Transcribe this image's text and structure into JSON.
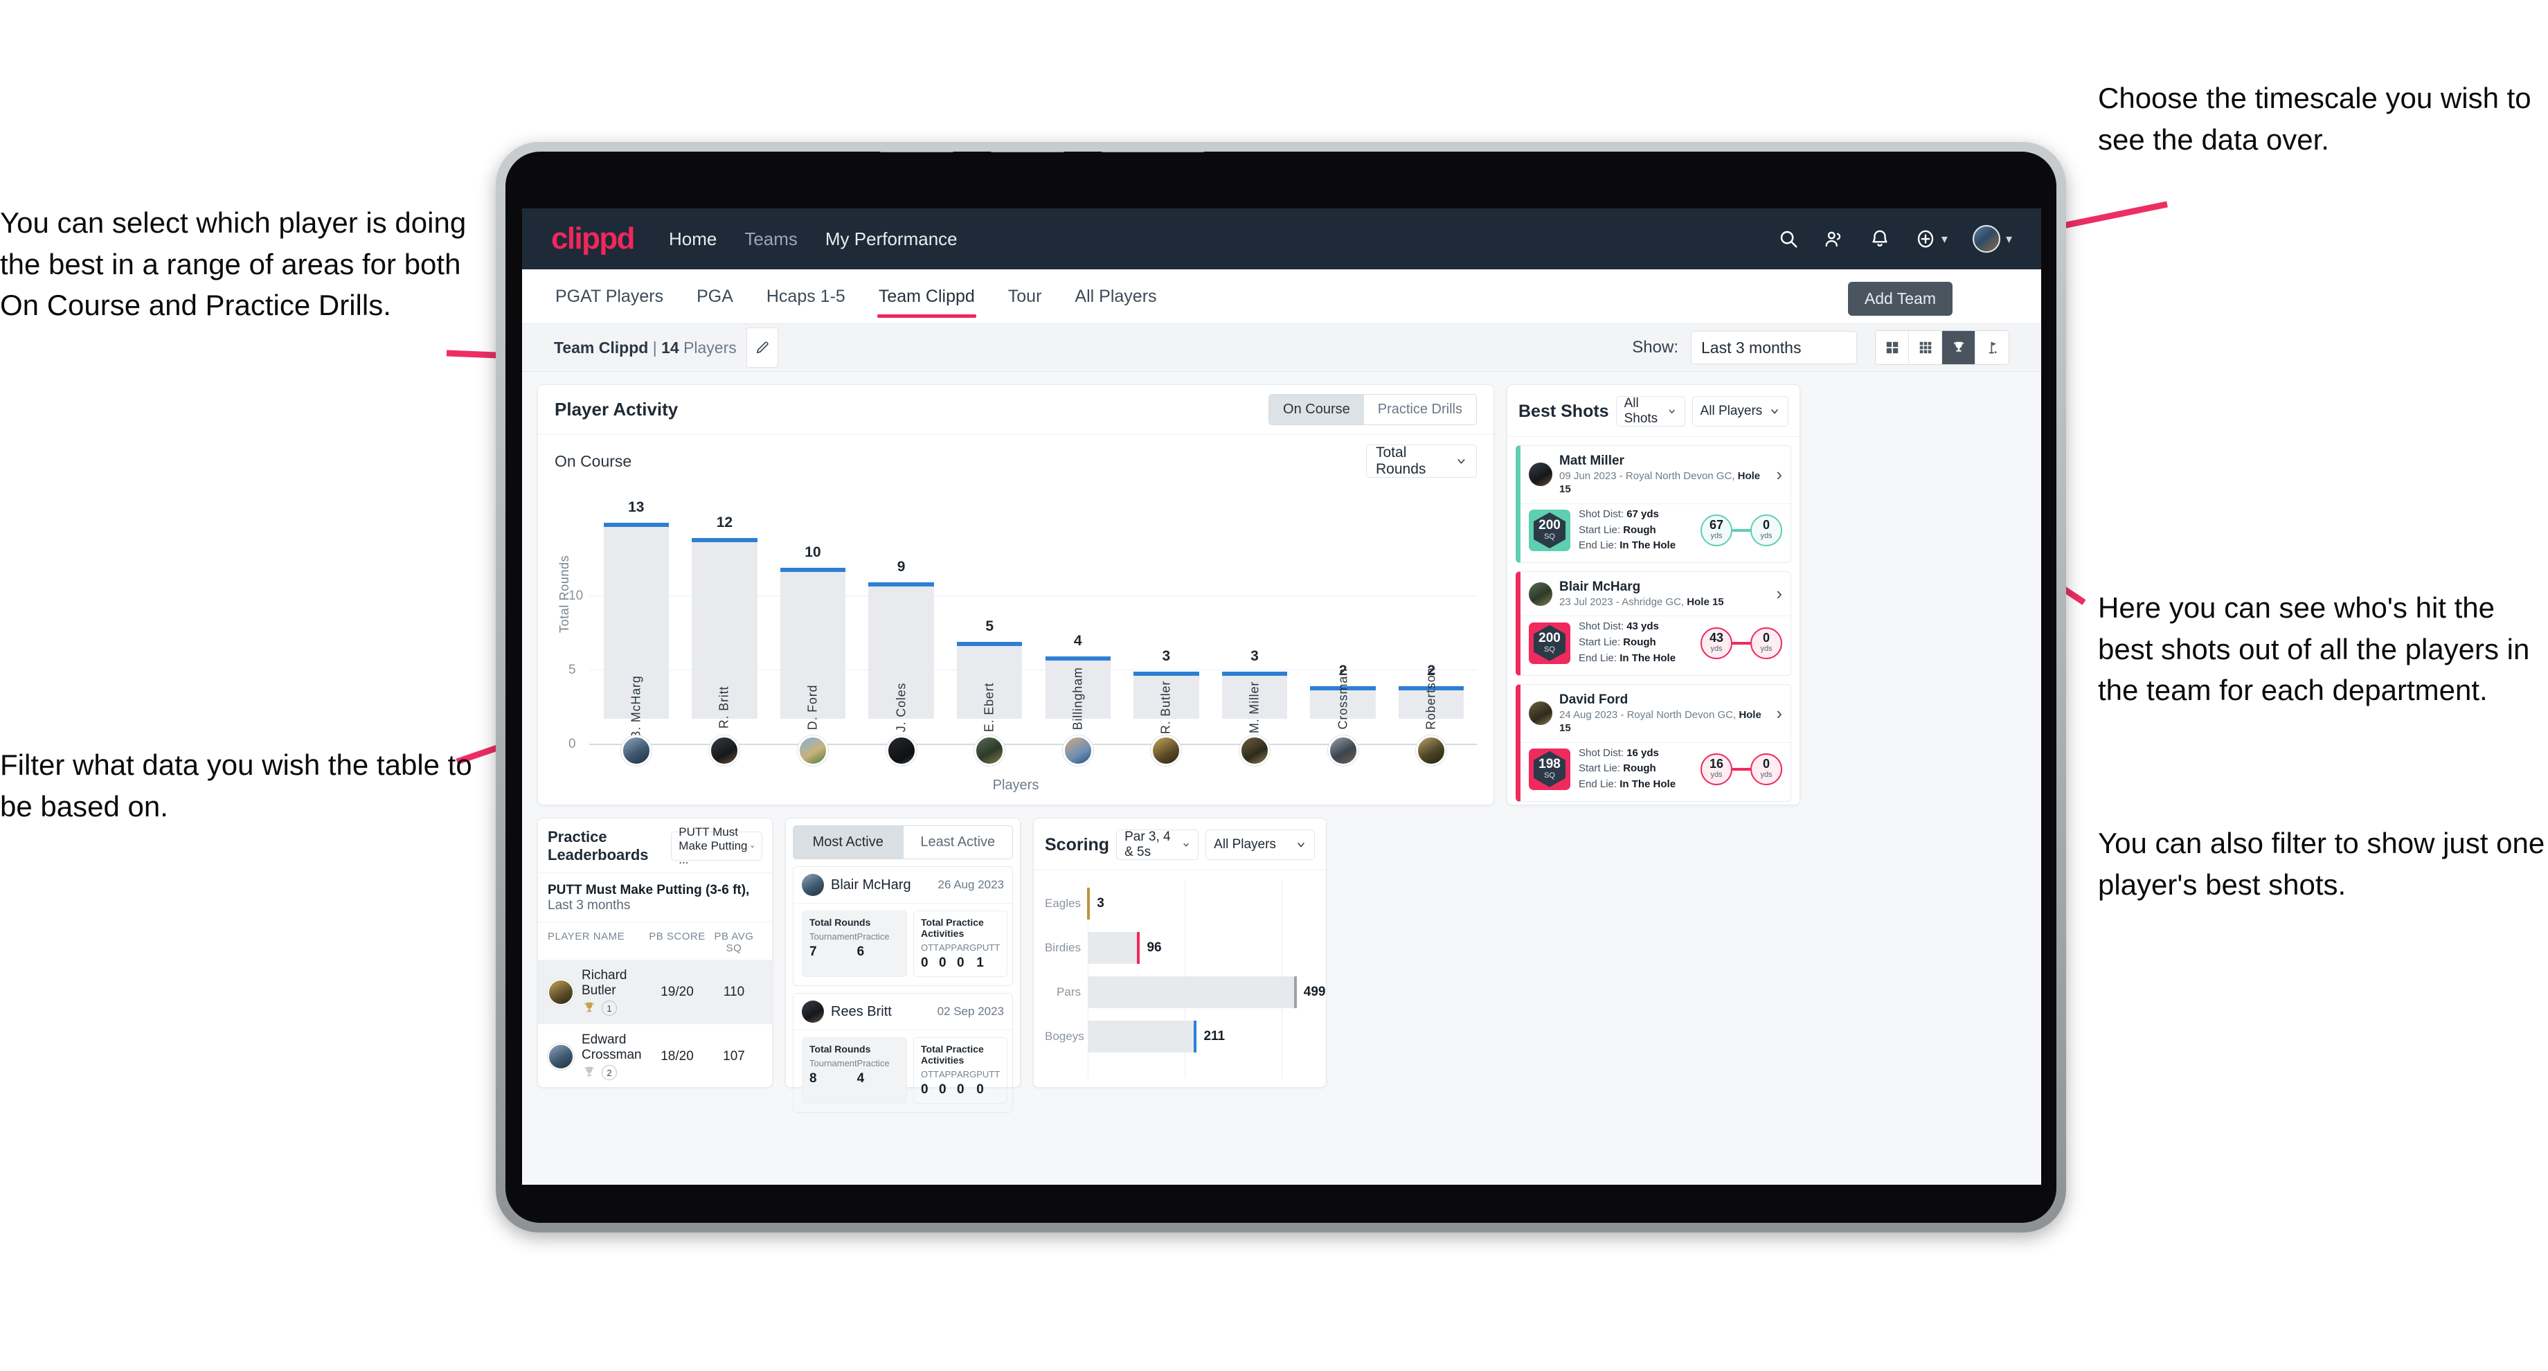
{
  "annotations": {
    "left_top": "You can select which player is doing the best in a range of areas for both On Course and Practice Drills.",
    "left_bottom": "Filter what data you wish the table to be based on.",
    "right_top": "Choose the timescale you wish to see the data over.",
    "right_mid": "Here you can see who's hit the best shots out of all the players in the team for each department.",
    "right_bottom": "You can also filter to show just one player's best shots."
  },
  "colors": {
    "brand_pink": "#f0275b",
    "nav_dark": "#1e2a38",
    "bar_blue": "#2e7fd4",
    "teal": "#5ecfb1",
    "gold": "#bd9340",
    "annotation_arrow": "#ed2e63"
  },
  "topnav": {
    "logo": "clippd",
    "links": [
      {
        "label": "Home",
        "active": true
      },
      {
        "label": "Teams",
        "active": false
      },
      {
        "label": "My Performance",
        "active": true
      }
    ],
    "icons": [
      "search-icon",
      "people-icon",
      "bell-icon",
      "plus-circle-icon",
      "avatar"
    ]
  },
  "tabs": [
    {
      "label": "PGAT Players",
      "active": false
    },
    {
      "label": "PGA",
      "active": false
    },
    {
      "label": "Hcaps 1-5",
      "active": false
    },
    {
      "label": "Team Clippd",
      "active": true
    },
    {
      "label": "Tour",
      "active": false
    },
    {
      "label": "All Players",
      "active": false
    }
  ],
  "tooltip": {
    "add_team": "Add Team"
  },
  "subbar": {
    "team_name": "Team Clippd",
    "separator": "|",
    "player_count": "14",
    "players_word": "Players",
    "edit_icon": "pencil-icon",
    "show_label": "Show:",
    "timescale_value": "Last 3 months",
    "view_toggles": [
      {
        "icon": "grid-4-icon",
        "active": false
      },
      {
        "icon": "grid-9-icon",
        "active": false
      },
      {
        "icon": "trophy-icon",
        "active": true
      },
      {
        "icon": "golf-flag-icon",
        "active": false
      }
    ]
  },
  "player_activity": {
    "title": "Player Activity",
    "segments": [
      {
        "label": "On Course",
        "active": true
      },
      {
        "label": "Practice Drills",
        "active": false
      }
    ],
    "sub_label": "On Course",
    "metric_select": "Total Rounds"
  },
  "chart_data": [
    {
      "type": "bar",
      "title": "Player Activity",
      "xlabel": "Players",
      "ylabel": "Total Rounds",
      "ylim": [
        0,
        14
      ],
      "yticks": [
        0,
        5,
        10
      ],
      "grid": true,
      "categories": [
        "B. McHarg",
        "R. Britt",
        "D. Ford",
        "J. Coles",
        "E. Ebert",
        "D. Billingham",
        "R. Butler",
        "M. Miller",
        "E. Crossman",
        "C. Robertson"
      ],
      "values": [
        13,
        12,
        10,
        9,
        5,
        4,
        3,
        3,
        2,
        2
      ]
    },
    {
      "type": "bar",
      "orientation": "horizontal",
      "title": "Scoring",
      "categories": [
        "Eagles",
        "Birdies",
        "Pars",
        "Bogeys"
      ],
      "values": [
        3,
        96,
        499,
        211
      ],
      "colors": [
        "#bd9340",
        "#f0275b",
        "#9aa3ab",
        "#2e7fd4"
      ],
      "xlim": [
        0,
        560
      ],
      "grid": true
    }
  ],
  "best_shots": {
    "title": "Best Shots",
    "shot_filter": "All Shots",
    "player_filter": "All Players",
    "cards": [
      {
        "name": "Matt Miller",
        "meta_prefix": "09 Jun 2023 - Royal North Devon GC,",
        "hole": "Hole 15",
        "sq": "200",
        "sq_unit": "SQ",
        "accent": "#5ecfb1",
        "shot_dist_label": "Shot Dist:",
        "shot_dist": "67 yds",
        "start_lie_label": "Start Lie:",
        "start_lie": "Rough",
        "end_lie_label": "End Lie:",
        "end_lie": "In The Hole",
        "from_value": "67",
        "from_unit": "yds",
        "to_value": "0",
        "to_unit": "yds"
      },
      {
        "name": "Blair McHarg",
        "meta_prefix": "23 Jul 2023 - Ashridge GC,",
        "hole": "Hole 15",
        "sq": "200",
        "sq_unit": "SQ",
        "accent": "#ef2a5e",
        "shot_dist_label": "Shot Dist:",
        "shot_dist": "43 yds",
        "start_lie_label": "Start Lie:",
        "start_lie": "Rough",
        "end_lie_label": "End Lie:",
        "end_lie": "In The Hole",
        "from_value": "43",
        "from_unit": "yds",
        "to_value": "0",
        "to_unit": "yds"
      },
      {
        "name": "David Ford",
        "meta_prefix": "24 Aug 2023 - Royal North Devon GC,",
        "hole": "Hole 15",
        "sq": "198",
        "sq_unit": "SQ",
        "accent": "#ef2a5e",
        "shot_dist_label": "Shot Dist:",
        "shot_dist": "16 yds",
        "start_lie_label": "Start Lie:",
        "start_lie": "Rough",
        "end_lie_label": "End Lie:",
        "end_lie": "In The Hole",
        "from_value": "16",
        "from_unit": "yds",
        "to_value": "0",
        "to_unit": "yds"
      }
    ]
  },
  "practice_leaderboards": {
    "title": "Practice Leaderboards",
    "drill_select": "PUTT Must Make Putting ...",
    "subtitle_bold": "PUTT Must Make Putting (3-6 ft),",
    "subtitle_rest": "Last 3 months",
    "columns": [
      "PLAYER NAME",
      "PB SCORE",
      "PB AVG SQ"
    ],
    "rows": [
      {
        "name": "Richard Butler",
        "rank": "1",
        "trophy": "gold",
        "pb_score": "19/20",
        "pb_avg_sq": "110",
        "highlight": true
      },
      {
        "name": "Edward Crossman",
        "rank": "2",
        "trophy": "silver",
        "pb_score": "18/20",
        "pb_avg_sq": "107",
        "highlight": false
      }
    ]
  },
  "activity_panel": {
    "tabs": [
      {
        "label": "Most Active",
        "active": true
      },
      {
        "label": "Least Active",
        "active": false
      }
    ],
    "rounds_title": "Total Rounds",
    "practice_title": "Total Practice Activities",
    "rounds_cols": [
      "Tournament",
      "Practice"
    ],
    "practice_cols": [
      "OTT",
      "APP",
      "ARG",
      "PUTT"
    ],
    "cards": [
      {
        "name": "Blair McHarg",
        "date": "26 Aug 2023",
        "tournament": "7",
        "practice": "6",
        "ott": "0",
        "app": "0",
        "arg": "0",
        "putt": "1"
      },
      {
        "name": "Rees Britt",
        "date": "02 Sep 2023",
        "tournament": "8",
        "practice": "4",
        "ott": "0",
        "app": "0",
        "arg": "0",
        "putt": "0"
      }
    ]
  },
  "scoring": {
    "title": "Scoring",
    "par_filter": "Par 3, 4 & 5s",
    "player_filter": "All Players",
    "rows": [
      {
        "label": "Eagles",
        "value": "3",
        "width_pct": 1.0,
        "color": "#bd9340"
      },
      {
        "label": "Birdies",
        "value": "96",
        "width_pct": 23.0,
        "color": "#f0275b"
      },
      {
        "label": "Pars",
        "value": "499",
        "width_pct": 92.0,
        "color": "#9aa3ab"
      },
      {
        "label": "Bogeys",
        "value": "211",
        "width_pct": 48.0,
        "color": "#2e7fd4"
      }
    ]
  }
}
